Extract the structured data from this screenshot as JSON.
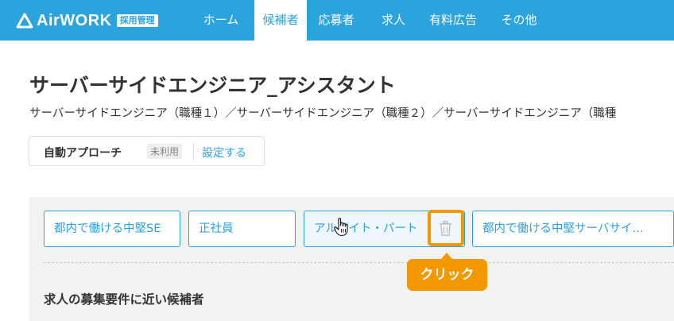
{
  "brand": {
    "name": "AirWORK",
    "badge": "採用管理",
    "primary_color": "#2ba3dc"
  },
  "nav": {
    "home": "ホーム",
    "candidates": "候補者",
    "applicants": "応募者",
    "jobs": "求人",
    "paid_ads": "有料広告",
    "other": "その他",
    "active": "candidates"
  },
  "page": {
    "title": "サーバーサイドエンジニア_アシスタント",
    "subtitle": "サーバーサイドエンジニア（職種１）／サーバーサイドエンジニア（職種２）／サーバーサイドエンジニア（職種"
  },
  "auto_approach": {
    "label": "自動アプローチ",
    "status": "未利用",
    "link": "設定する"
  },
  "search_tabs": [
    {
      "label": "都内で働ける中堅SE"
    },
    {
      "label": "正社員"
    },
    {
      "label": "アルバイト・パート"
    },
    {
      "label": "都内で働ける中堅サーバサイ…"
    }
  ],
  "annotation": {
    "callout": "クリック",
    "highlight_color": "#f39800",
    "target_icon": "trash-icon"
  },
  "section": {
    "heading": "求人の募集要件に近い候補者"
  }
}
